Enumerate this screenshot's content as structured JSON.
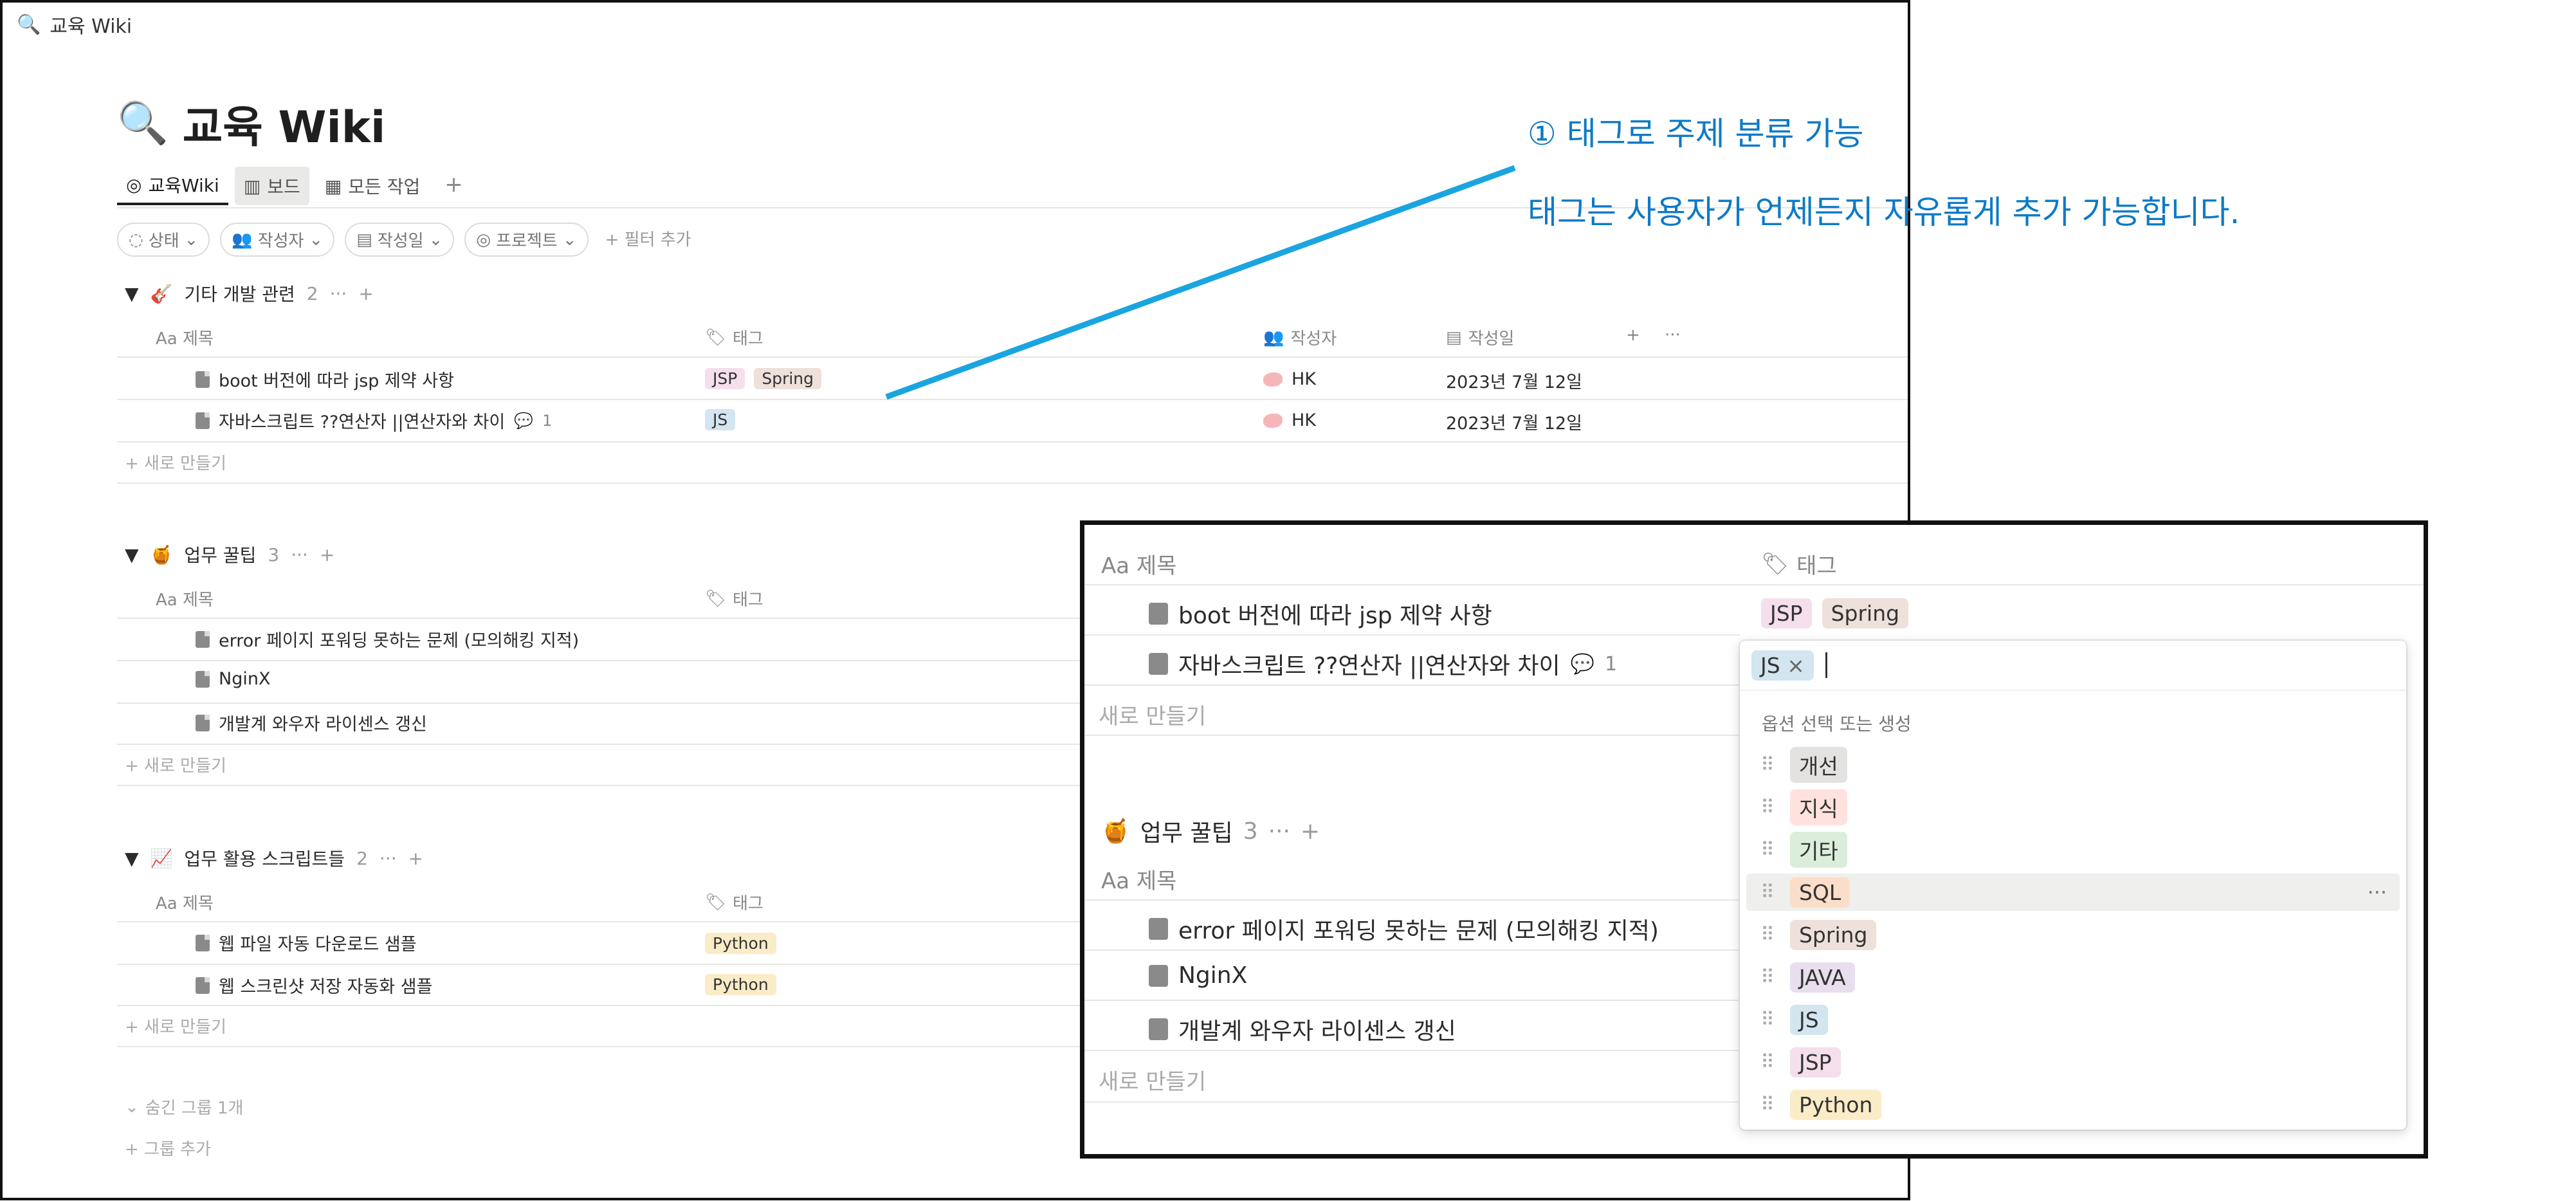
{
  "window": {
    "title": "교육 Wiki"
  },
  "page": {
    "icon": "magnifier-icon",
    "title": "교육 Wiki"
  },
  "views": [
    {
      "label": "교육Wiki"
    },
    {
      "label": "보드"
    },
    {
      "label": "모든 작업"
    }
  ],
  "view_add": "+",
  "filters": [
    {
      "label": "상태"
    },
    {
      "label": "작성자"
    },
    {
      "label": "작성일"
    },
    {
      "label": "프로젝트"
    }
  ],
  "filter_add": "+ 필터 추가",
  "columns": {
    "title": "Aa 제목",
    "tags": "태그",
    "author": "작성자",
    "date": "작성일"
  },
  "groups": [
    {
      "name": "기타 개발 관련",
      "count": "2",
      "rows": [
        {
          "title": "boot 버전에 따라 jsp 제약 사항",
          "tags": [
            "JSP",
            "Spring"
          ],
          "author": "HK",
          "date": "2023년 7월 12일"
        },
        {
          "title": "자바스크립트 ??연산자 ||연산자와 차이",
          "comment": "1",
          "tags": [
            "JS"
          ],
          "author": "HK",
          "date": "2023년 7월 12일"
        }
      ]
    },
    {
      "name": "업무 꿀팁",
      "count": "3",
      "rows": [
        {
          "title": "error 페이지 포워딩 못하는 문제 (모의해킹 지적)"
        },
        {
          "title": "NginX"
        },
        {
          "title": "개발계 와우자 라이센스 갱신"
        }
      ]
    },
    {
      "name": "업무 활용 스크립트들",
      "count": "2",
      "rows": [
        {
          "title": "웹 파일 자동 다운로드 샘플",
          "tags": [
            "Python"
          ]
        },
        {
          "title": "웹 스크린샷 저장 자동화 샘플",
          "tags": [
            "Python"
          ]
        }
      ]
    }
  ],
  "new_row": "+ 새로 만들기",
  "hidden_groups": "숨긴 그룹 1개",
  "add_group": "+ 그룹 추가",
  "annotation": {
    "heading": "① 태그로 주제 분류 가능",
    "body": "태그는 사용자가 언제든지 자유롭게 추가 가능합니다.",
    "color": "#0d7ac6"
  },
  "zoom": {
    "columns": {
      "title": "Aa 제목",
      "tags": "태그"
    },
    "rows": [
      {
        "title": "boot 버전에 따라 jsp 제약 사항",
        "tags": [
          "JSP",
          "Spring"
        ]
      },
      {
        "title": "자바스크립트 ??연산자 ||연산자와 차이",
        "comment": "1"
      }
    ],
    "new_row": "새로 만들기",
    "group": {
      "name": "업무 꿀팁",
      "count": "3"
    },
    "group_rows": [
      {
        "title": "error 페이지 포워딩 못하는 문제 (모의해킹 지적)"
      },
      {
        "title": "NginX"
      },
      {
        "title": "개발계 와우자 라이센스 갱신"
      }
    ],
    "group_new_row": "새로 만들기",
    "dropdown": {
      "selected_tag": "JS",
      "hint": "옵션 선택 또는 생성",
      "options": [
        "개선",
        "지식",
        "기타",
        "SQL",
        "Spring",
        "JAVA",
        "JS",
        "JSP",
        "Python"
      ],
      "more": "···"
    }
  }
}
